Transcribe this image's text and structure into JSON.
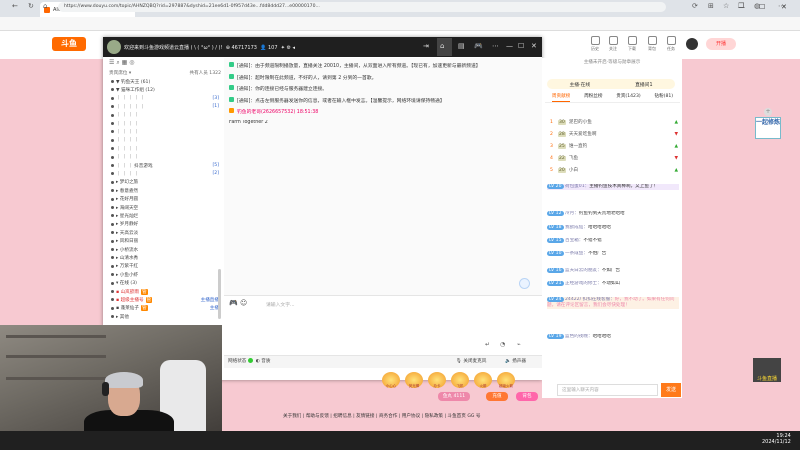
{
  "browser": {
    "tab_title": "AI6·斗鱼直播间",
    "url": "https://www.douyu.com/topic/AHNZQBQ?rid=297887&dyshid=21ee6d1-0f957d43e...fdd8ddd27...e00000170...",
    "new_tab": "+",
    "win_min": "—",
    "win_max": "☐",
    "win_close": "✕",
    "back": "←",
    "refresh": "↻",
    "home": "⌂"
  },
  "site": {
    "logo": "斗鱼",
    "header_icons": [
      {
        "icon": "history-icon",
        "label": "历史"
      },
      {
        "icon": "follow-icon",
        "label": "关注"
      },
      {
        "icon": "download-icon",
        "label": "下载"
      },
      {
        "icon": "backpack-icon",
        "label": "背包"
      },
      {
        "icon": "task-icon",
        "label": "任务"
      }
    ],
    "open_live": "开播"
  },
  "popup": {
    "title": "欢迎来到斗鱼游戏频道云直播 ( \\ ( °ω° ) / )!",
    "room_id": "46717173",
    "viewers": "107",
    "member_search_placeholder": "搜索用户"
  },
  "members": {
    "header_left": "贵宾席位 ▾",
    "header_right": "共有人员 1322",
    "rows": [
      {
        "name": "▼ 钓鱼天王 (61)",
        "badge": "",
        "num": "",
        "red": false
      },
      {
        "name": "▼ 猫咪工作组 (12)",
        "badge": "",
        "num": "",
        "red": false
      },
      {
        "name": "｜ ｜ ｜  ｜ ｜",
        "badge": "",
        "num": "[3]",
        "red": false
      },
      {
        "name": "｜ ｜ ｜  ｜ ｜",
        "badge": "",
        "num": "[1]",
        "red": false
      },
      {
        "name": "｜ ｜  ｜  ｜",
        "badge": "",
        "num": "",
        "red": false
      },
      {
        "name": "｜ ｜ ｜  ｜",
        "badge": "",
        "num": "",
        "red": false
      },
      {
        "name": "｜ ｜  ｜  ｜",
        "badge": "",
        "num": "",
        "red": false
      },
      {
        "name": "｜ ｜ ｜  ｜",
        "badge": "",
        "num": "",
        "red": false
      },
      {
        "name": "｜ ｜ ｜  ｜",
        "badge": "",
        "num": "",
        "red": false
      },
      {
        "name": "｜ ｜ ｜  ｜",
        "badge": "",
        "num": "",
        "red": false
      },
      {
        "name": "｜ ｜  ｜ 抖音游戏",
        "badge": "",
        "num": "[5]",
        "red": false
      },
      {
        "name": "｜ ｜ ｜  ｜",
        "badge": "",
        "num": "[2]",
        "red": false
      },
      {
        "name": "▸ 梦幻之旅",
        "badge": "",
        "num": "",
        "red": false
      },
      {
        "name": "▸ 春意盎然",
        "badge": "",
        "num": "",
        "red": false
      },
      {
        "name": "▸ 花好月圆",
        "badge": "",
        "num": "",
        "red": false
      },
      {
        "name": "▸ 海阔天空",
        "badge": "",
        "num": "",
        "red": false
      },
      {
        "name": "▸ 星光灿烂",
        "badge": "",
        "num": "",
        "red": false
      },
      {
        "name": "▸ 岁月静好",
        "badge": "",
        "num": "",
        "red": false
      },
      {
        "name": "▸ 天高云淡",
        "badge": "",
        "num": "",
        "red": false
      },
      {
        "name": "▸ 风和日丽",
        "badge": "",
        "num": "",
        "red": false
      },
      {
        "name": "▸ 小桥流水",
        "badge": "",
        "num": "",
        "red": false
      },
      {
        "name": "▸ 山清水秀",
        "badge": "",
        "num": "",
        "red": false
      },
      {
        "name": "▸ 万紫千红",
        "badge": "",
        "num": "",
        "red": false
      },
      {
        "name": "▸ 小鱼小虾",
        "badge": "",
        "num": "",
        "red": false
      },
      {
        "name": "▾ 在线 (3)",
        "badge": "",
        "num": "",
        "red": false
      },
      {
        "name": "▪ 山岚欲雨",
        "badge": "管",
        "num": "",
        "red": true
      },
      {
        "name": "▪ 超级主播号",
        "badge": "管",
        "num": "主播直播",
        "red": true
      },
      {
        "name": "▪ 蓬莱仙子",
        "badge": "管",
        "num": "主播",
        "red": false
      },
      {
        "name": "▸ 其他",
        "badge": "",
        "num": "",
        "red": false
      }
    ]
  },
  "chat": {
    "lines": [
      {
        "type": "sys",
        "text": "[通知]：由于频道限制播放量，直播关注 20010，主播间，从双面进入所有频道。【现已有，加速更新与最新频道】"
      },
      {
        "type": "sys",
        "text": "[通知]：超时限制在此频道，不好的人，请到第 2 分到的一首歌。"
      },
      {
        "type": "sys",
        "text": "[通知]：你的连接已经与服务器建立连接。"
      },
      {
        "type": "sys",
        "text": "[通知]：点击左侧服务器发送你的信息，或者在输入框中发言。【温馨提示，网络环境请保持畅通】"
      },
      {
        "type": "user",
        "text": "钓鱼的老哥(2626657532)  18:51:38"
      },
      {
        "type": "msg",
        "text": "Farm Together 2"
      }
    ],
    "input_placeholder": "请输入文字...",
    "send_shortcut": "Enter"
  },
  "popup_footer": {
    "left": "网络状态",
    "mode": "音质",
    "mic": "关闭麦克风",
    "speaker": "扬声器"
  },
  "gifts": {
    "items": [
      "小心心",
      "荧光棒",
      "办卡",
      "飞机",
      "火箭",
      "超级火箭"
    ],
    "balance": "鱼丸 4111",
    "recharge": "充值",
    "gift_btn": "背包"
  },
  "rpanel": {
    "top_note": "主播未开启·等级与勋章展示",
    "pills": [
      "主播·在线",
      "直播间1"
    ],
    "tabs": [
      "周贡献榜",
      "周粉丝榜",
      "贵宾(1423)",
      "钻粉(81)"
    ],
    "rank": [
      {
        "n": "1",
        "lv": "30",
        "name": "泥巴的小鱼",
        "arrow": "▲"
      },
      {
        "name": "天天爱吃鱼啊",
        "n": "2",
        "lv": "28",
        "arrow": "▼"
      },
      {
        "n": "3",
        "lv": "25",
        "name": "谁一直钓",
        "arrow": "▲"
      },
      {
        "n": "4",
        "lv": "22",
        "name": "飞鱼",
        "arrow": "▼"
      },
      {
        "n": "5",
        "lv": "20",
        "name": "小白",
        "arrow": "▲"
      }
    ],
    "messages": [
      {
        "lvl": "LV 20",
        "name": "荷包蛋01：",
        "text": "主播钓鱼技术真棒啊，又上鱼了！",
        "hl": "hl2"
      },
      {
        "lvl": "LV 12",
        "name": "冷月：",
        "text": "钓鱼钓到天荒地老哈哈",
        "hl": ""
      },
      {
        "lvl": "LV 18",
        "name": "我欲成仙：",
        "text": "哈哈哈哈哈",
        "hl": ""
      },
      {
        "lvl": "LV 15",
        "name": "百宝箱：",
        "text": "不错不错",
        "hl": ""
      },
      {
        "lvl": "LV 10",
        "name": "一条咸鱼：",
        "text": "不怕广告",
        "hl": ""
      },
      {
        "lvl": "LV 16",
        "name": "蓝天白云的朋友：",
        "text": "不如广告",
        "hl": ""
      },
      {
        "lvl": "LV 21",
        "name": "正经游戏的修士：",
        "text": "不动如山",
        "hl": ""
      },
      {
        "lvl": "LV 24",
        "name": "24422/ 扣扣在线客服：",
        "text": "好，我不动了。如果有任何问题，请在评论区留言，我们会尽快处理！",
        "hl": "hl"
      },
      {
        "lvl": "LV 19",
        "name": "蓝色的夜晚：",
        "text": "哈哈哈哈",
        "hl": ""
      }
    ],
    "input_placeholder": "这里输入聊天内容",
    "send": "发送"
  },
  "side": {
    "deco_text": "一起修炼",
    "logo_text": "斗鱼直播"
  },
  "footer_links": "关于我们 | 帮助与反馈 | 招聘信息 | 友情链接 | 商务合作 | 用户协议 | 隐私政策 | 斗鱼首页 GG 号",
  "taskbar": {
    "time": "19:24",
    "date": "2024/11/12"
  }
}
